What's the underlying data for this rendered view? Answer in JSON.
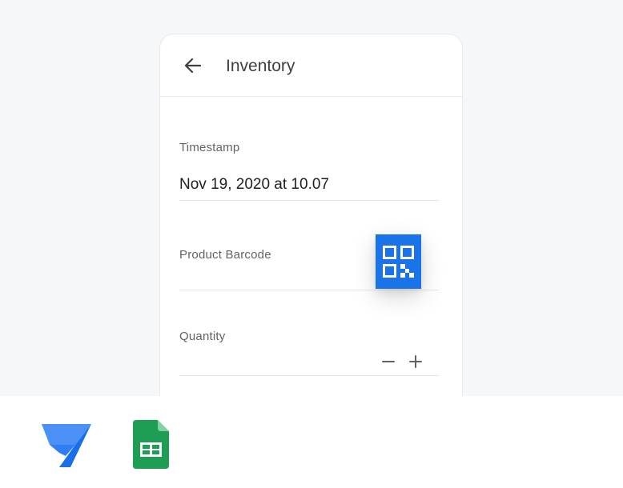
{
  "header": {
    "title": "Inventory",
    "back_icon": "arrow-back-icon"
  },
  "form": {
    "fields": [
      {
        "label": "Timestamp",
        "value": "Nov 19, 2020 at 10.07"
      },
      {
        "label": "Product Barcode",
        "value": "",
        "action_icon": "qr-code-icon"
      },
      {
        "label": "Quantity",
        "value": "",
        "controls": [
          "minus-icon",
          "plus-icon"
        ]
      }
    ]
  },
  "logos": [
    "appsheet-logo",
    "google-sheets-logo"
  ],
  "colors": {
    "accent": "#1a73e8",
    "page_background": "#f6f7f9",
    "sheets_green": "#1e9e55",
    "appsheet_blue": "#2f7ef5"
  }
}
